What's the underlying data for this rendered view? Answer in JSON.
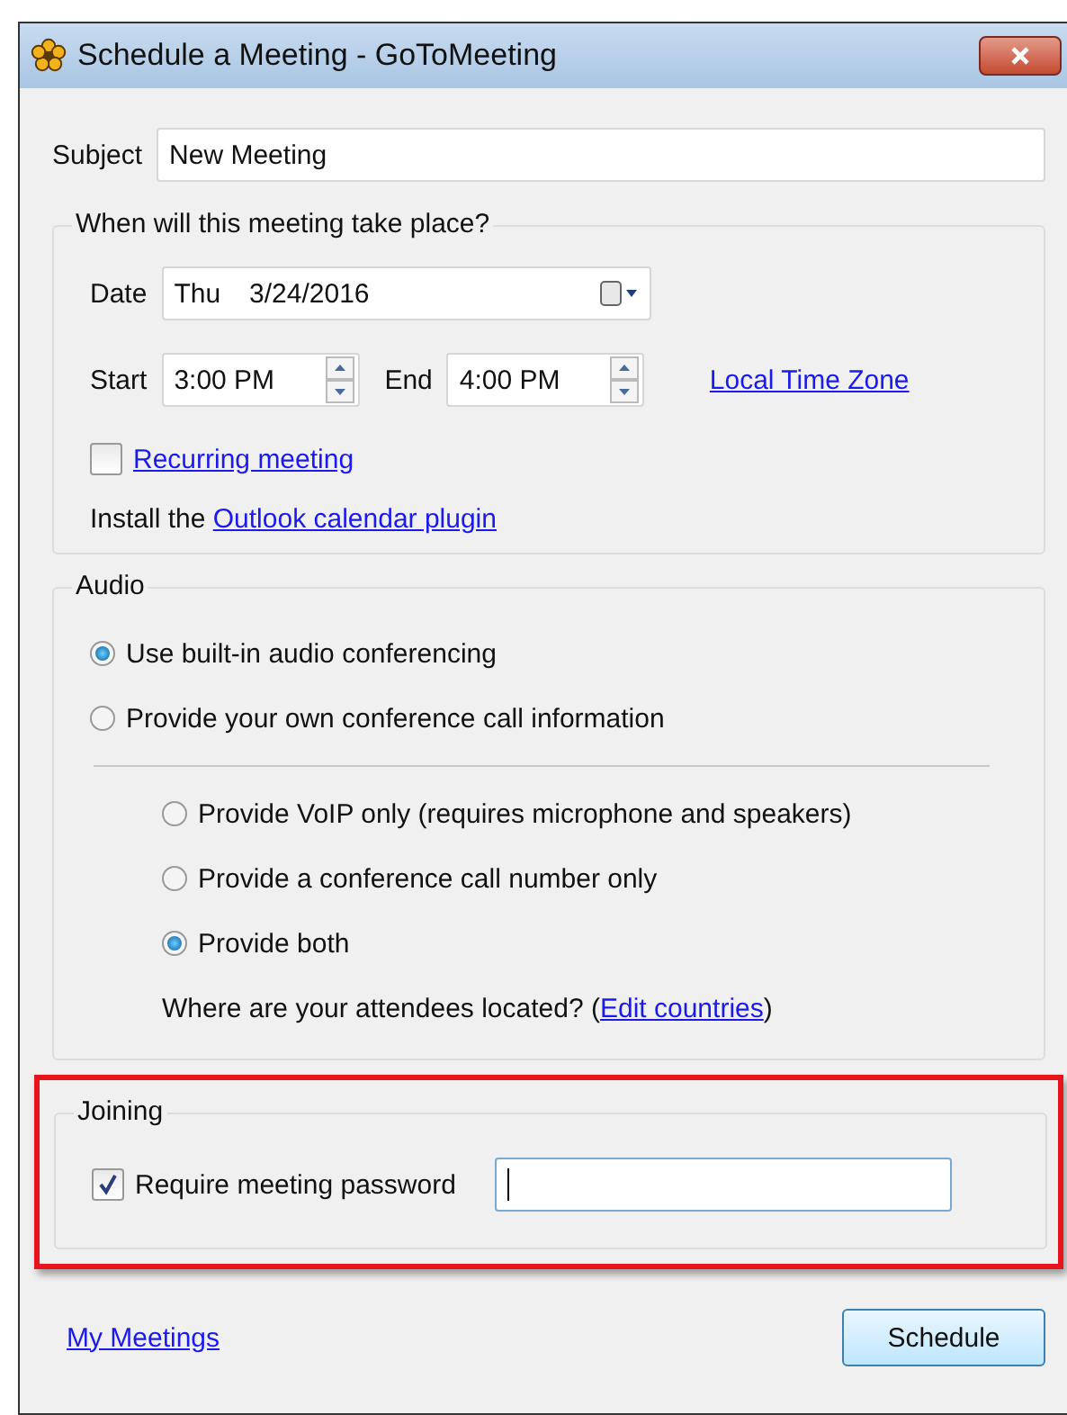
{
  "window": {
    "title": "Schedule a Meeting - GoToMeeting"
  },
  "subject": {
    "label": "Subject",
    "value": "New Meeting"
  },
  "when": {
    "legend": "When will this meeting take place?",
    "date": {
      "label": "Date",
      "day": "Thu",
      "value": "3/24/2016"
    },
    "start": {
      "label": "Start",
      "value": "3:00 PM"
    },
    "end": {
      "label": "End",
      "value": "4:00 PM"
    },
    "time_zone_link": "Local Time Zone",
    "recurring": {
      "label": "Recurring meeting",
      "checked": false
    },
    "plugin": {
      "prefix": "Install the ",
      "link": "Outlook calendar plugin"
    }
  },
  "audio": {
    "legend": "Audio",
    "options": [
      {
        "label": "Use built-in audio conferencing",
        "selected": true
      },
      {
        "label": "Provide your own conference call information",
        "selected": false,
        "children": [
          {
            "label": "Provide VoIP only (requires microphone and speakers)",
            "selected": false
          },
          {
            "label": "Provide a conference call number only",
            "selected": false
          },
          {
            "label": "Provide both",
            "selected": true
          }
        ]
      }
    ],
    "note": {
      "prefix": "Where are your attendees located? (",
      "link": "Edit countries",
      "suffix": ")"
    }
  },
  "joining": {
    "legend": "Joining",
    "highlighted": true,
    "password": {
      "label": "Require meeting password",
      "checked": true,
      "focused": true
    }
  },
  "footer": {
    "link": "My Meetings",
    "button": "Schedule"
  }
}
